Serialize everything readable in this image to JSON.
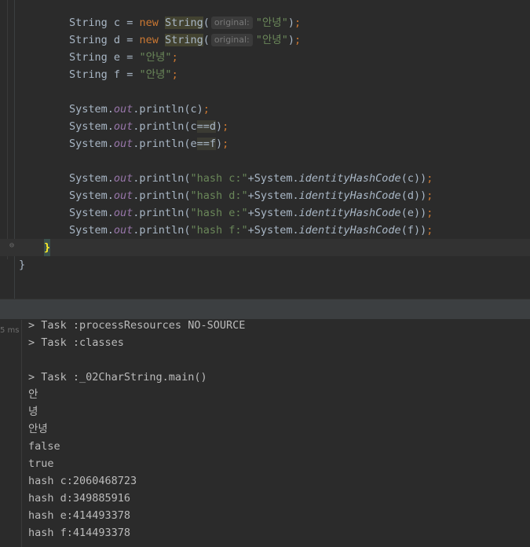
{
  "editor": {
    "lines": {
      "l1": {
        "type": "String",
        "var": "c",
        "eq": " = ",
        "kw": "new",
        "ctor": "String",
        "hint": "original:",
        "arg": "\"안녕\"",
        "end": ");"
      },
      "l2": {
        "type": "String",
        "var": "d",
        "eq": " = ",
        "kw": "new",
        "ctor": "String",
        "hint": "original:",
        "arg": "\"안녕\"",
        "end": ");"
      },
      "l3": {
        "type": "String",
        "var": "e",
        "eq": " = ",
        "str": "\"안녕\"",
        "end": ";"
      },
      "l4": {
        "type": "String",
        "var": "f",
        "eq": " = ",
        "str": "\"안녕\"",
        "end": ";"
      },
      "p1": {
        "cls": "System.",
        "field": "out",
        "call": ".println(c)",
        "end": ";"
      },
      "p2": {
        "cls": "System.",
        "field": "out",
        "call": ".println(c",
        "op": "==",
        "arg": "d",
        "close": ")",
        "end": ";"
      },
      "p3": {
        "cls": "System.",
        "field": "out",
        "call": ".println(e",
        "op": "==",
        "arg": "f",
        "close": ")",
        "end": ";"
      },
      "h1": {
        "cls": "System.",
        "field": "out",
        "call": ".println(",
        "str": "\"hash c:\"",
        "plus": "+System.",
        "method": "identityHashCode",
        "args": "(c))",
        "end": ";"
      },
      "h2": {
        "cls": "System.",
        "field": "out",
        "call": ".println(",
        "str": "\"hash d:\"",
        "plus": "+System.",
        "method": "identityHashCode",
        "args": "(d))",
        "end": ";"
      },
      "h3": {
        "cls": "System.",
        "field": "out",
        "call": ".println(",
        "str": "\"hash e:\"",
        "plus": "+System.",
        "method": "identityHashCode",
        "args": "(e))",
        "end": ";"
      },
      "h4": {
        "cls": "System.",
        "field": "out",
        "call": ".println(",
        "str": "\"hash f:\"",
        "plus": "+System.",
        "method": "identityHashCode",
        "args": "(f))",
        "end": ";"
      },
      "close_method": "}",
      "close_class": "}"
    }
  },
  "console": {
    "timing": "5 ms",
    "lines": [
      "> Task :processResources NO-SOURCE",
      "> Task :classes",
      "",
      "> Task :_02CharString.main()",
      "안",
      "녕",
      "안녕",
      "false",
      "true",
      "hash c:2060468723",
      "hash d:349885916",
      "hash e:414493378",
      "hash f:414493378"
    ]
  }
}
